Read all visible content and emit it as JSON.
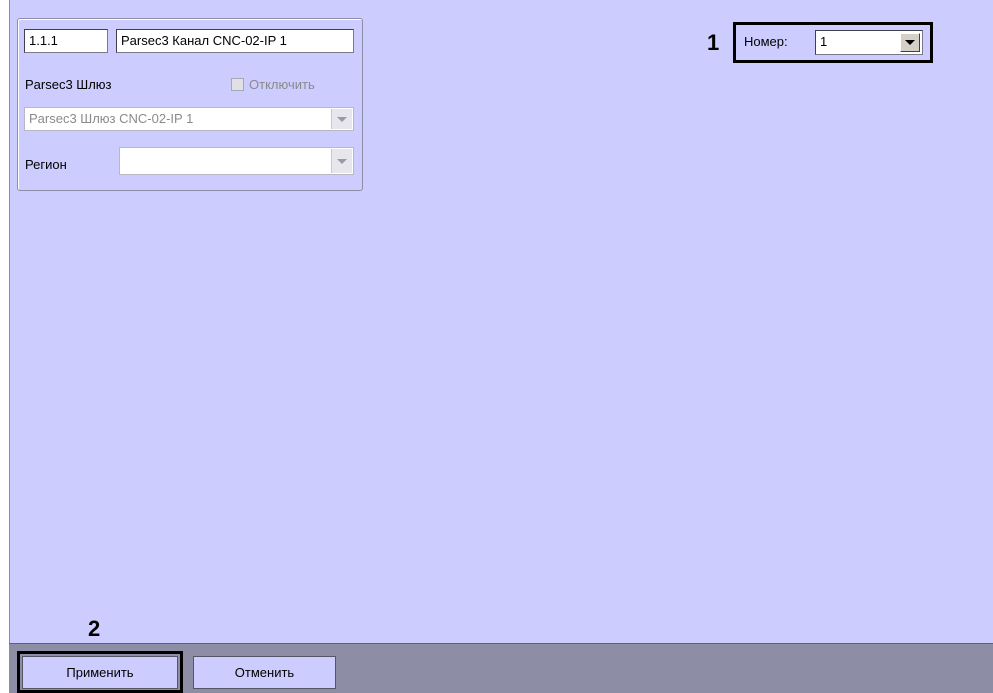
{
  "panel": {
    "id_value": "1.1.1",
    "name_value": "Parsec3 Канал CNC-02-IP 1",
    "gateway_label": "Parsec3 Шлюз",
    "disable_label": "Отключить",
    "gateway_select": "Parsec3 Шлюз CNC-02-IP 1",
    "region_label": "Регион",
    "region_select": ""
  },
  "number": {
    "label": "Номер:",
    "value": "1"
  },
  "markers": {
    "one": "1",
    "two": "2"
  },
  "buttons": {
    "apply": "Применить",
    "cancel": "Отменить"
  },
  "icons": {
    "dropdown": "chevron-down-icon",
    "checkbox": "checkbox-icon"
  },
  "colors": {
    "background": "#ccccfe",
    "bottom_bar": "#8d8da5",
    "callout": "#000000"
  }
}
